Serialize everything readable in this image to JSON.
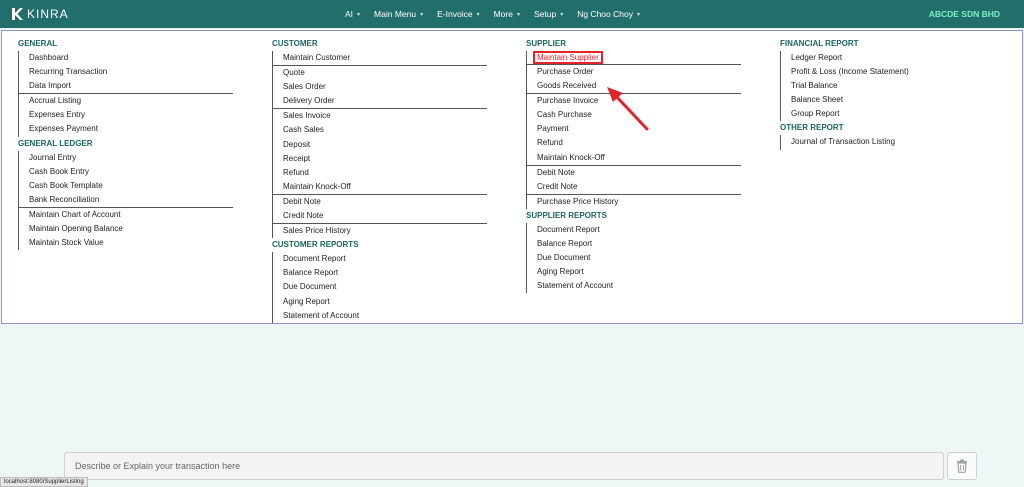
{
  "brand": {
    "logo_text": "KINRA"
  },
  "nav": {
    "items": [
      {
        "label": "AI",
        "has_caret": true
      },
      {
        "label": "Main Menu",
        "has_caret": true
      },
      {
        "label": "E-Invoice",
        "has_caret": true
      },
      {
        "label": "More",
        "has_caret": true
      },
      {
        "label": "Setup",
        "has_caret": true
      },
      {
        "label": "Ng Choo Choy",
        "has_caret": true
      }
    ],
    "company": "ABCDE SDN BHD"
  },
  "menu": {
    "general": {
      "title": "GENERAL",
      "groups": [
        [
          "Dashboard",
          "Recurring Transaction",
          "Data Import"
        ],
        [
          "Accrual Listing",
          "Expenses Entry",
          "Expenses Payment"
        ]
      ]
    },
    "general_ledger": {
      "title": "GENERAL LEDGER",
      "groups": [
        [
          "Journal Entry",
          "Cash Book Entry",
          "Cash Book Template",
          "Bank Reconciliation"
        ],
        [
          "Maintain Chart of Account",
          "Maintain Opening Balance",
          "Maintain Stock Value"
        ]
      ]
    },
    "customer": {
      "title": "CUSTOMER",
      "groups": [
        [
          "Maintain Customer"
        ],
        [
          "Quote",
          "Sales Order",
          "Delivery Order"
        ],
        [
          "Sales Invoice",
          "Cash Sales",
          "Deposit",
          "Receipt",
          "Refund",
          "Maintain Knock-Off"
        ],
        [
          "Debit Note",
          "Credit Note"
        ],
        [
          "Sales Price History"
        ]
      ]
    },
    "customer_reports": {
      "title": "CUSTOMER REPORTS",
      "groups": [
        [
          "Document Report",
          "Balance Report",
          "Due Document",
          "Aging Report",
          "Statement of Account"
        ]
      ]
    },
    "supplier": {
      "title": "SUPPLIER",
      "highlighted": "Maintain Supplier",
      "groups": [
        [
          "Purchase Order",
          "Goods Received"
        ],
        [
          "Purchase Invoice",
          "Cash Purchase",
          "Payment",
          "Refund",
          "Maintain Knock-Off"
        ],
        [
          "Debit Note",
          "Credit Note"
        ],
        [
          "Purchase Price History"
        ]
      ]
    },
    "supplier_reports": {
      "title": "SUPPLIER REPORTS",
      "groups": [
        [
          "Document Report",
          "Balance Report",
          "Due Document",
          "Aging Report",
          "Statement of Account"
        ]
      ]
    },
    "financial_report": {
      "title": "FINANCIAL REPORT",
      "groups": [
        [
          "Ledger Report",
          "Profit & Loss (Income Statement)",
          "Trial Balance",
          "Balance Sheet",
          "Group Report"
        ]
      ]
    },
    "other_report": {
      "title": "OTHER REPORT",
      "groups": [
        [
          "Journal of Transaction Listing"
        ]
      ]
    }
  },
  "chat": {
    "placeholder": "Describe or Explain your transaction here",
    "clear_icon": "trash-icon"
  },
  "status_bar": {
    "url": "localhost:8080/SupplierListing"
  },
  "colors": {
    "navbar": "#226e6a",
    "section_title": "#1c6664",
    "company": "#7ff0cb",
    "highlight": "#e3242b",
    "menu_border": "#8e8fd0",
    "page_bg": "#eef6f6"
  }
}
